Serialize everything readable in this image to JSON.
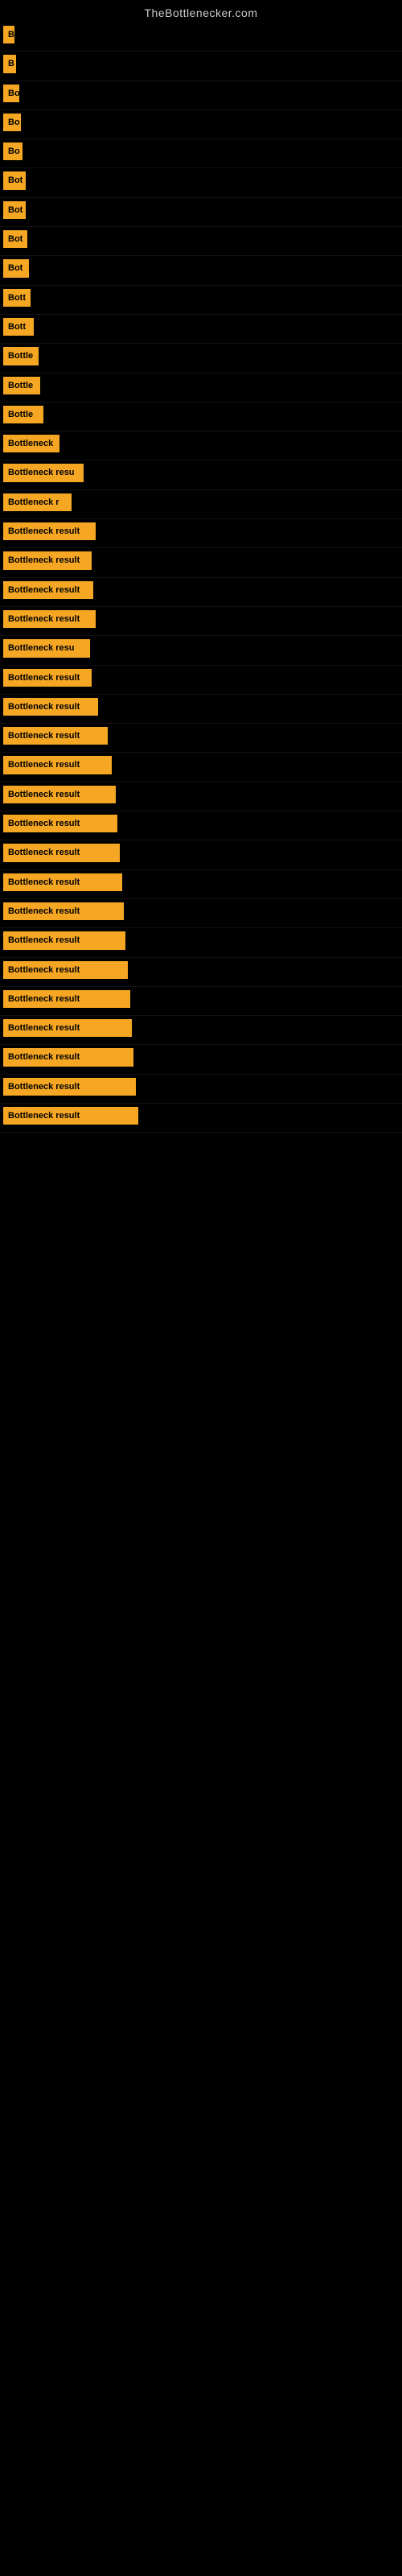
{
  "site_title": "TheBottlenecker.com",
  "bars": [
    {
      "label": "B",
      "width": 14
    },
    {
      "label": "B",
      "width": 16
    },
    {
      "label": "Bo",
      "width": 20
    },
    {
      "label": "Bo",
      "width": 22
    },
    {
      "label": "Bo",
      "width": 24
    },
    {
      "label": "Bot",
      "width": 28
    },
    {
      "label": "Bot",
      "width": 28
    },
    {
      "label": "Bot",
      "width": 30
    },
    {
      "label": "Bot",
      "width": 32
    },
    {
      "label": "Bott",
      "width": 34
    },
    {
      "label": "Bott",
      "width": 38
    },
    {
      "label": "Bottle",
      "width": 44
    },
    {
      "label": "Bottle",
      "width": 46
    },
    {
      "label": "Bottle",
      "width": 50
    },
    {
      "label": "Bottleneck",
      "width": 70
    },
    {
      "label": "Bottleneck resu",
      "width": 100
    },
    {
      "label": "Bottleneck r",
      "width": 85
    },
    {
      "label": "Bottleneck result",
      "width": 115
    },
    {
      "label": "Bottleneck result",
      "width": 110
    },
    {
      "label": "Bottleneck result",
      "width": 112
    },
    {
      "label": "Bottleneck result",
      "width": 115
    },
    {
      "label": "Bottleneck resu",
      "width": 108
    },
    {
      "label": "Bottleneck result",
      "width": 110
    },
    {
      "label": "Bottleneck result",
      "width": 118
    },
    {
      "label": "Bottleneck result",
      "width": 130
    },
    {
      "label": "Bottleneck result",
      "width": 135
    },
    {
      "label": "Bottleneck result",
      "width": 140
    },
    {
      "label": "Bottleneck result",
      "width": 142
    },
    {
      "label": "Bottleneck result",
      "width": 145
    },
    {
      "label": "Bottleneck result",
      "width": 148
    },
    {
      "label": "Bottleneck result",
      "width": 150
    },
    {
      "label": "Bottleneck result",
      "width": 152
    },
    {
      "label": "Bottleneck result",
      "width": 155
    },
    {
      "label": "Bottleneck result",
      "width": 158
    },
    {
      "label": "Bottleneck result",
      "width": 160
    },
    {
      "label": "Bottleneck result",
      "width": 162
    },
    {
      "label": "Bottleneck result",
      "width": 165
    },
    {
      "label": "Bottleneck result",
      "width": 168
    }
  ]
}
